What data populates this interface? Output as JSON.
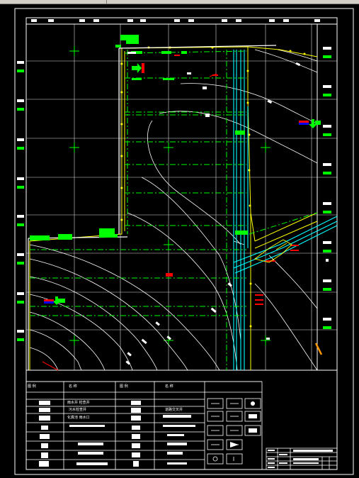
{
  "window": {
    "title": ""
  },
  "drawing": {
    "background": "#000000",
    "colors": {
      "frame": "#ffffff",
      "grid": "#ffffff",
      "boundary": "#ffff00",
      "pipe": "#00ffff",
      "green": "#00ff00",
      "red": "#ff0000",
      "blue": "#0000ff",
      "orange": "#ff9900",
      "contour": "#ffffff"
    }
  },
  "legend": {
    "headers": [
      "图 例",
      "名 称",
      "图 例",
      "名 称"
    ],
    "left_names": [
      "雨水井 检查井",
      "污水检查井",
      "化粪池 雨水口",
      "",
      "",
      "",
      ""
    ],
    "right_names": [
      "",
      "",
      "道路交叉井",
      "",
      "",
      "",
      ""
    ]
  },
  "symbols_panel": {
    "title": ""
  },
  "title_block": {
    "title": ""
  }
}
